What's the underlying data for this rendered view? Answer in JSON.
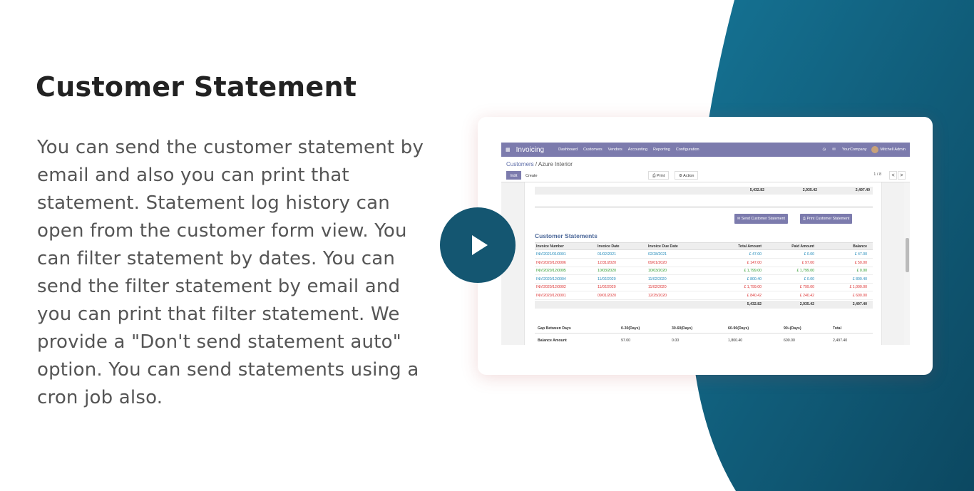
{
  "heading": "Customer Statement",
  "description": "You can send the customer statement by email and also you can print that statement. Statement log history can open from the customer form view. You can filter statement by dates. You can send the filter statement by email and you can print that filter statement. We provide a \"Don't send statement auto\" option. You can send statements using a cron job also.",
  "colors": {
    "accent_teal": "#145671",
    "odoo_purple": "#7c7bad",
    "blob_gradient_start": "#13708f",
    "blob_gradient_end": "#0d4a63"
  },
  "play_button": {
    "icon": "play-icon"
  },
  "screenshot": {
    "navbar": {
      "grid_icon": "apps-grid-icon",
      "app_name": "Invoicing",
      "menus": [
        "Dashboard",
        "Customers",
        "Vendors",
        "Accounting",
        "Reporting",
        "Configuration"
      ],
      "clock_icon": "clock-icon",
      "chat_icon": "chat-icon",
      "company": "YourCompany",
      "user": "Mitchell Admin"
    },
    "breadcrumb": {
      "parent": "Customers",
      "separator": " / ",
      "current": "Azure Interior"
    },
    "buttons": {
      "edit": "Edit",
      "create": "Create",
      "print": "Print",
      "action": "Action"
    },
    "pager": {
      "text": "1 / 8",
      "prev": "<",
      "next": ">"
    },
    "top_totals": {
      "total": "5,432.82",
      "paid": "2,935.42",
      "balance": "2,497.40"
    },
    "statement_buttons": {
      "send": "Send Customer Statement",
      "print": "Print Customer Statement"
    },
    "section_title": "Customer Statements",
    "table": {
      "headers": [
        "Invoice Number",
        "Invoice Date",
        "Invoice Due Date",
        "Total Amount",
        "Paid Amount",
        "Balance"
      ],
      "rows": [
        {
          "number": "INV/2021/01/0001",
          "date": "01/02/2021",
          "due": "02/28/2021",
          "total": "£ 47.00",
          "paid": "£ 0.00",
          "balance": "£ 47.00",
          "color": "blue"
        },
        {
          "number": "INV/2020/12/0006",
          "date": "12/31/2020",
          "due": "09/01/2020",
          "total": "£ 147.00",
          "paid": "£ 97.00",
          "balance": "£ 50.00",
          "color": "red"
        },
        {
          "number": "INV/2020/12/0005",
          "date": "10/03/2020",
          "due": "10/03/2020",
          "total": "£ 1,799.00",
          "paid": "£ 1,799.00",
          "balance": "£ 0.00",
          "color": "green"
        },
        {
          "number": "INV/2020/12/0004",
          "date": "11/02/2020",
          "due": "11/02/2020",
          "total": "£ 800.40",
          "paid": "£ 0.00",
          "balance": "£ 800.40",
          "color": "blue"
        },
        {
          "number": "INV/2020/12/0002",
          "date": "11/02/2020",
          "due": "11/02/2020",
          "total": "£ 1,799.00",
          "paid": "£ 799.00",
          "balance": "£ 1,000.00",
          "color": "red"
        },
        {
          "number": "INV/2020/12/0001",
          "date": "09/01/2020",
          "due": "12/25/2020",
          "total": "£ 840.42",
          "paid": "£ 240.42",
          "balance": "£ 600.00",
          "color": "red"
        }
      ],
      "totals": {
        "total": "5,432.82",
        "paid": "2,935.42",
        "balance": "2,497.40"
      }
    },
    "gap_table": {
      "headers": [
        "Gap Between Days",
        "0-30(Days)",
        "30-60(Days)",
        "60-90(Days)",
        "90+(Days)",
        "Total"
      ],
      "row": [
        "Balance Amount",
        "97.00",
        "0.00",
        "1,800.40",
        "600.00",
        "2,497.40"
      ]
    }
  }
}
